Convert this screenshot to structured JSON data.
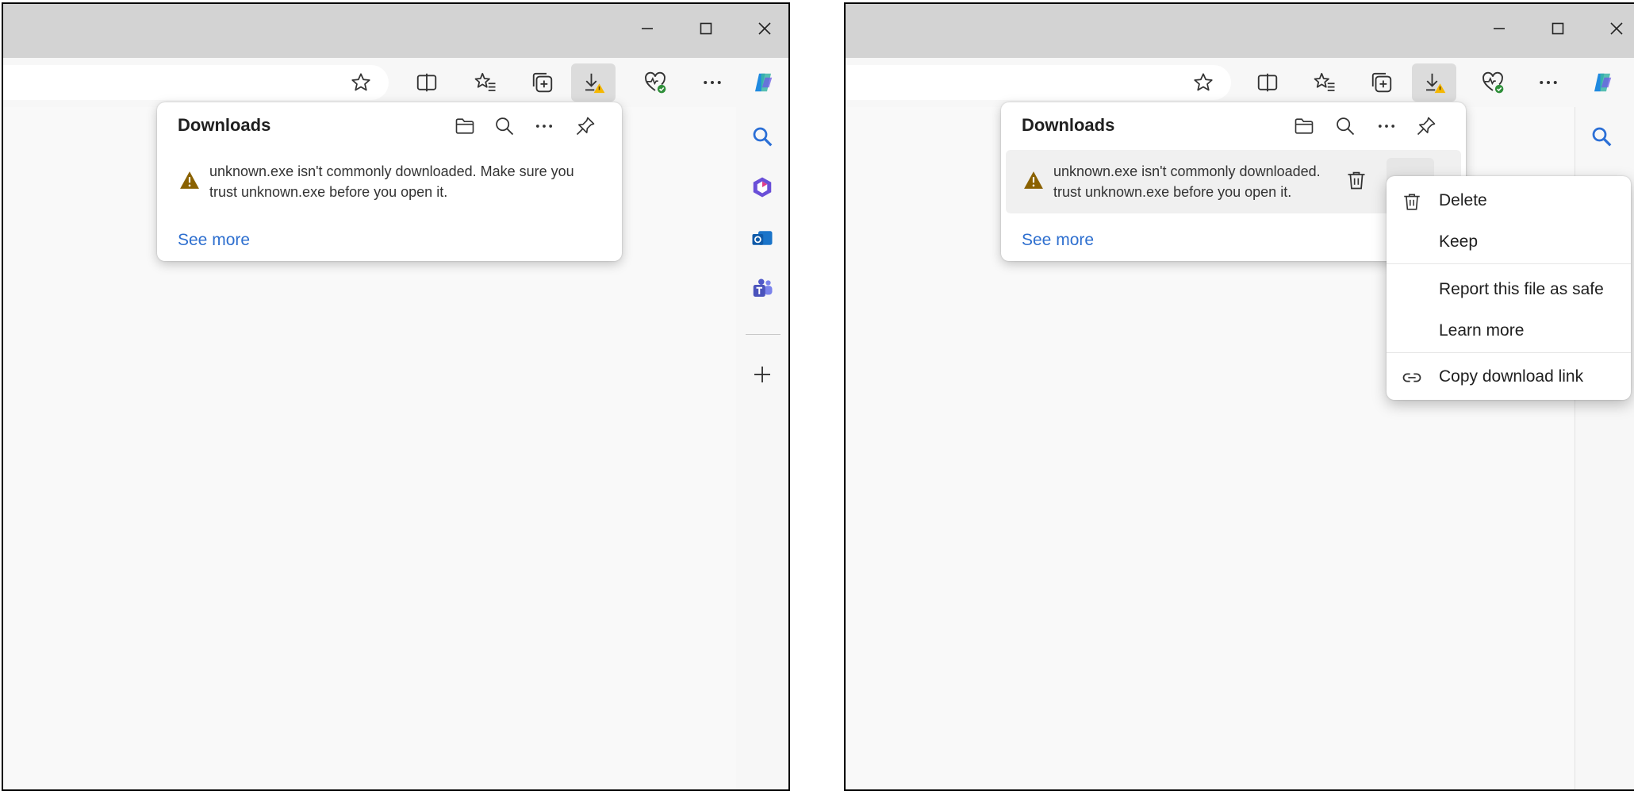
{
  "downloads": {
    "title": "Downloads",
    "warning_line1": "unknown.exe isn't commonly downloaded. Make sure you",
    "warning_line2": "trust unknown.exe before you open it.",
    "see_more": "See more"
  },
  "context_menu": {
    "items": [
      {
        "label": "Delete",
        "icon": "trash-icon"
      },
      {
        "label": "Keep",
        "icon": ""
      },
      {
        "label": "Report this file as safe",
        "icon": ""
      },
      {
        "label": "Learn more",
        "icon": ""
      },
      {
        "label": "Copy download link",
        "icon": "link-icon"
      }
    ]
  },
  "colors": {
    "accent_link": "#2e6fcf",
    "warning": "#8a6100",
    "badge_warning": "#f5b700",
    "health_badge": "#2f8f3a",
    "titlebar": "#d3d3d3"
  },
  "icons": [
    "minimize-icon",
    "maximize-icon",
    "close-icon",
    "star-icon",
    "split-screen-icon",
    "favorites-icon",
    "collections-icon",
    "download-warning-icon",
    "browser-essentials-icon",
    "more-icon",
    "copilot-icon",
    "search-icon",
    "copilot-365-icon",
    "outlook-icon",
    "teams-icon",
    "add-icon",
    "folder-icon",
    "pin-icon",
    "warning-icon",
    "trash-icon",
    "link-icon"
  ]
}
